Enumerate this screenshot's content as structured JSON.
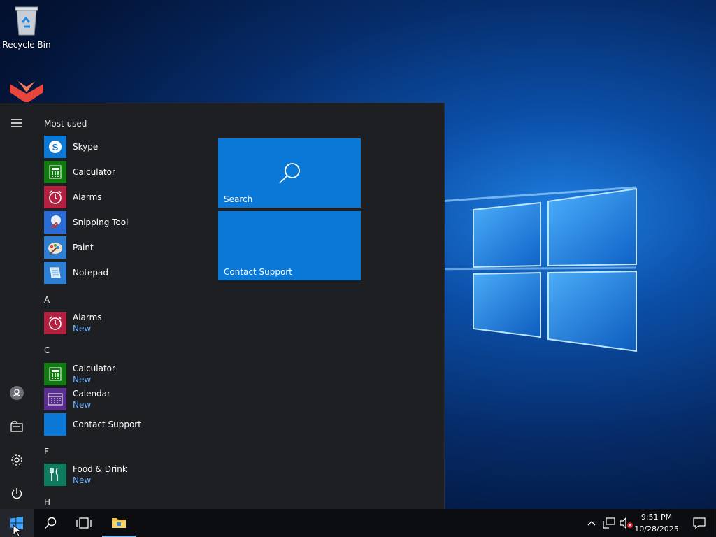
{
  "desktop": {
    "icons": [
      {
        "label": "Recycle Bin",
        "icon": "recycle-bin-icon"
      },
      {
        "label": "",
        "icon": "app-logo-icon"
      }
    ]
  },
  "start_menu": {
    "most_used_heading": "Most used",
    "most_used": [
      {
        "label": "Skype",
        "icon": "skype-icon",
        "color": "#0a78d6"
      },
      {
        "label": "Calculator",
        "icon": "calculator-icon",
        "color": "#107c10"
      },
      {
        "label": "Alarms",
        "icon": "alarm-clock-icon",
        "color": "#b4203f"
      },
      {
        "label": "Snipping Tool",
        "icon": "snipping-tool-icon",
        "color": "#2b6bd6"
      },
      {
        "label": "Paint",
        "icon": "paint-icon",
        "color": "#2d7fd3"
      },
      {
        "label": "Notepad",
        "icon": "notepad-icon",
        "color": "#2d7fd3"
      }
    ],
    "sections": [
      {
        "letter": "A",
        "items": [
          {
            "label": "Alarms",
            "sub": "New",
            "icon": "alarm-clock-icon",
            "color": "#b4203f"
          }
        ]
      },
      {
        "letter": "C",
        "items": [
          {
            "label": "Calculator",
            "sub": "New",
            "icon": "calculator-icon",
            "color": "#107c10"
          },
          {
            "label": "Calendar",
            "sub": "New",
            "icon": "calendar-icon",
            "color": "#5c2d91"
          },
          {
            "label": "Contact Support",
            "sub": "",
            "icon": "contact-support-icon",
            "color": "#0a78d6"
          }
        ]
      },
      {
        "letter": "F",
        "items": [
          {
            "label": "Food & Drink",
            "sub": "New",
            "icon": "food-drink-icon",
            "color": "#0f7b5f"
          }
        ]
      },
      {
        "letter": "H",
        "items": []
      }
    ],
    "tiles": [
      {
        "label": "Search",
        "icon": "search-icon"
      },
      {
        "label": "Contact Support",
        "icon": ""
      }
    ]
  },
  "taskbar": {
    "time": "9:51 PM",
    "date": "10/28/2025"
  }
}
